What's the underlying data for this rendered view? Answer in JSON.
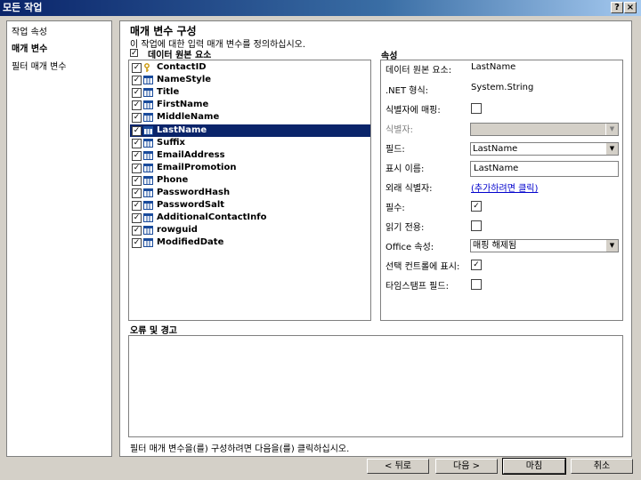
{
  "window": {
    "title": "모든 작업",
    "help_button": "?",
    "close_button": "×"
  },
  "nav": {
    "items": [
      {
        "label": "작업 속성",
        "active": false
      },
      {
        "label": "매개 변수",
        "active": true
      },
      {
        "label": "필터 매개 변수",
        "active": false
      }
    ]
  },
  "main": {
    "title": "매개 변수 구성",
    "subtitle": "이 작업에 대한 입력 매개 변수를 정의하십시오.",
    "tree_header": "데이터 원본 요소",
    "tree_header_checked": true,
    "properties_header": "속성",
    "errors_header": "오류 및 경고",
    "footer_note": "필터 매개 변수을(를) 구성하려면 다음을(를) 클릭하십시오."
  },
  "fields": [
    {
      "name": "ContactID",
      "checked": true,
      "icon": "key-icon",
      "selected": false
    },
    {
      "name": "NameStyle",
      "checked": true,
      "icon": "column-icon",
      "selected": false
    },
    {
      "name": "Title",
      "checked": true,
      "icon": "column-icon",
      "selected": false
    },
    {
      "name": "FirstName",
      "checked": true,
      "icon": "column-icon",
      "selected": false
    },
    {
      "name": "MiddleName",
      "checked": true,
      "icon": "column-icon",
      "selected": false
    },
    {
      "name": "LastName",
      "checked": true,
      "icon": "column-icon",
      "selected": true
    },
    {
      "name": "Suffix",
      "checked": true,
      "icon": "column-icon",
      "selected": false
    },
    {
      "name": "EmailAddress",
      "checked": true,
      "icon": "column-icon",
      "selected": false
    },
    {
      "name": "EmailPromotion",
      "checked": true,
      "icon": "column-icon",
      "selected": false
    },
    {
      "name": "Phone",
      "checked": true,
      "icon": "column-icon",
      "selected": false
    },
    {
      "name": "PasswordHash",
      "checked": true,
      "icon": "column-icon",
      "selected": false
    },
    {
      "name": "PasswordSalt",
      "checked": true,
      "icon": "column-icon",
      "selected": false
    },
    {
      "name": "AdditionalContactInfo",
      "checked": true,
      "icon": "column-icon",
      "selected": false
    },
    {
      "name": "rowguid",
      "checked": true,
      "icon": "column-icon",
      "selected": false
    },
    {
      "name": "ModifiedDate",
      "checked": true,
      "icon": "column-icon",
      "selected": false
    }
  ],
  "properties": {
    "data_source_element": {
      "label": "데이터 원본 요소:",
      "value": "LastName"
    },
    "net_type": {
      "label": ".NET 형식:",
      "value": "System.String"
    },
    "map_to_identifier": {
      "label": "식별자에 매핑:",
      "checked": false
    },
    "identifier": {
      "label": "식별자:",
      "value": "",
      "disabled": true
    },
    "field": {
      "label": "필드:",
      "value": "LastName"
    },
    "display_name": {
      "label": "표시 이름:",
      "value": "LastName"
    },
    "foreign_identifier": {
      "label": "외래 식별자:",
      "link": "(추가하려면 클릭)"
    },
    "required": {
      "label": "필수:",
      "checked": true
    },
    "read_only": {
      "label": "읽기 전용:",
      "checked": false
    },
    "office_property": {
      "label": "Office 속성:",
      "value": "매핑 해제됨"
    },
    "show_in_picker": {
      "label": "선택 컨트롤에 표시:",
      "checked": true
    },
    "timestamp_field": {
      "label": "타임스탬프 필드:",
      "checked": false
    }
  },
  "buttons": {
    "back": "< 뒤로",
    "next": "다음 >",
    "finish": "마침",
    "cancel": "취소"
  }
}
